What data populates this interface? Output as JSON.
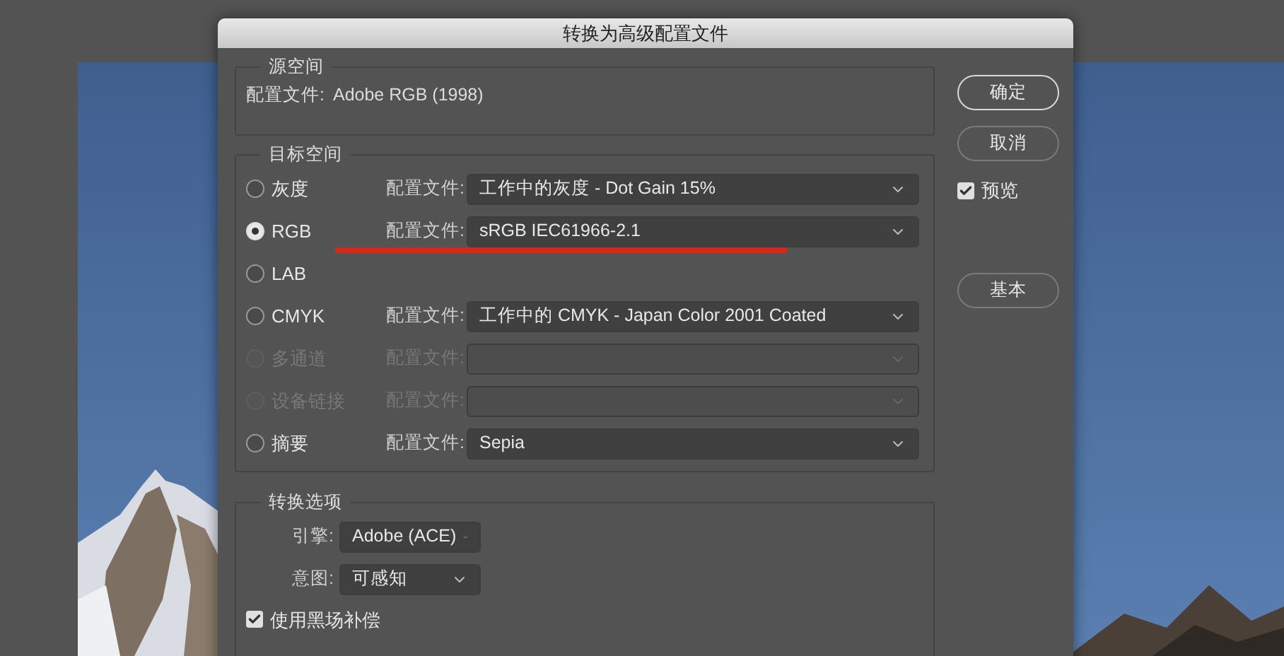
{
  "dialog": {
    "title": "转换为高级配置文件",
    "source_space": {
      "title": "源空间",
      "label": "配置文件:",
      "value": "Adobe RGB (1998)"
    },
    "target_space": {
      "title": "目标空间",
      "options": [
        {
          "label": "灰度",
          "selected": false,
          "disabled": false,
          "profile_label": "配置文件:",
          "profile": "工作中的灰度 - Dot Gain 15%"
        },
        {
          "label": "RGB",
          "selected": true,
          "disabled": false,
          "profile_label": "配置文件:",
          "profile": "sRGB IEC61966-2.1",
          "underlined": true
        },
        {
          "label": "LAB",
          "selected": false,
          "disabled": false
        },
        {
          "label": "CMYK",
          "selected": false,
          "disabled": false,
          "profile_label": "配置文件:",
          "profile": "工作中的 CMYK - Japan Color 2001 Coated"
        },
        {
          "label": "多通道",
          "selected": false,
          "disabled": true,
          "profile_label": "配置文件:"
        },
        {
          "label": "设备链接",
          "selected": false,
          "disabled": true,
          "profile_label": "配置文件:"
        },
        {
          "label": "摘要",
          "selected": false,
          "disabled": false,
          "profile_label": "配置文件:",
          "profile": "Sepia"
        }
      ]
    },
    "conversion_options": {
      "title": "转换选项",
      "selects": [
        {
          "label": "引擎:",
          "value": "Adobe (ACE)"
        },
        {
          "label": "意图:",
          "value": "可感知"
        }
      ],
      "checkboxes": [
        {
          "label": "使用黑场补偿",
          "checked": true,
          "disabled": false
        }
      ]
    },
    "actions": [
      {
        "kind": "button",
        "label": "确定",
        "default": true
      },
      {
        "kind": "button",
        "label": "取消",
        "default": false
      },
      {
        "kind": "checkbox",
        "label": "预览",
        "checked": true
      },
      {
        "kind": "button",
        "label": "基本",
        "default": false
      }
    ]
  }
}
